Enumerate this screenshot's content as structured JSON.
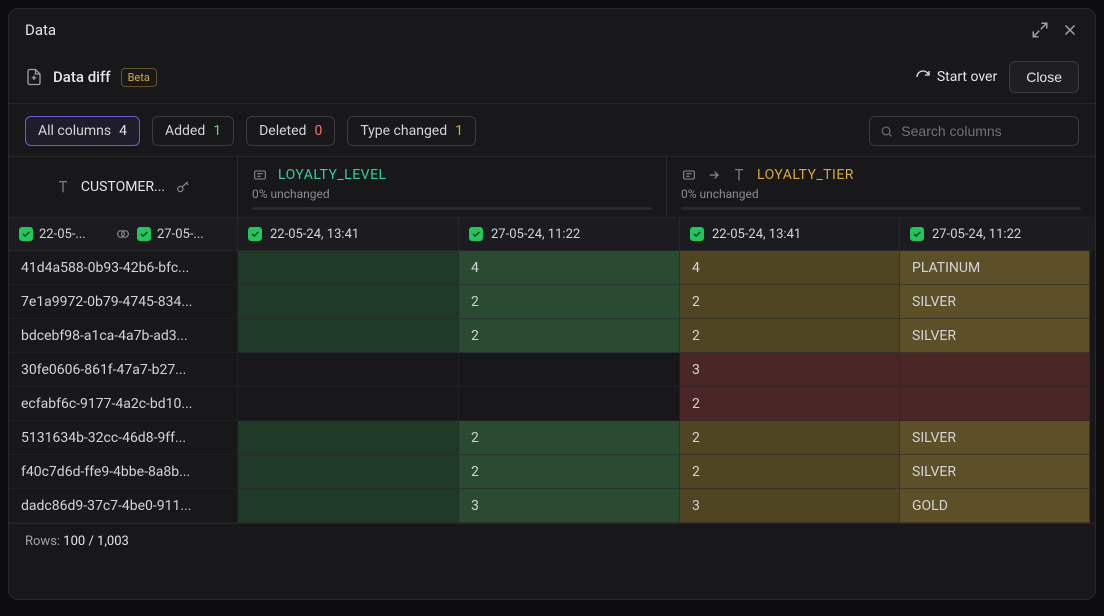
{
  "titlebar": {
    "title": "Data"
  },
  "toolbar": {
    "title": "Data diff",
    "badge": "Beta",
    "start_over": "Start over",
    "close": "Close"
  },
  "filters": {
    "all_columns": {
      "label": "All columns",
      "count": "4"
    },
    "added": {
      "label": "Added",
      "count": "1"
    },
    "deleted": {
      "label": "Deleted",
      "count": "0"
    },
    "type_changed": {
      "label": "Type changed",
      "count": "1"
    }
  },
  "search": {
    "placeholder": "Search columns"
  },
  "columns": {
    "id": {
      "label": "CUSTOMER..."
    },
    "loyalty_level": {
      "label": "LOYALTY_LEVEL",
      "sub": "0% unchanged"
    },
    "loyalty_tier": {
      "label": "LOYALTY_TIER",
      "sub": "0% unchanged"
    }
  },
  "snapshots": {
    "a": "22-05-24, 13:41",
    "b": "27-05-24, 11:22",
    "a_short": "22-05-...",
    "b_short": "27-05-..."
  },
  "rows": [
    {
      "id": "41d4a588-0b93-42b6-bfc...",
      "ll_a": "",
      "ll_b": "4",
      "lt_a": "4",
      "lt_b": "PLATINUM",
      "variant": "changed"
    },
    {
      "id": "7e1a9972-0b79-4745-834...",
      "ll_a": "",
      "ll_b": "2",
      "lt_a": "2",
      "lt_b": "SILVER",
      "variant": "changed"
    },
    {
      "id": "bdcebf98-a1ca-4a7b-ad3...",
      "ll_a": "",
      "ll_b": "2",
      "lt_a": "2",
      "lt_b": "SILVER",
      "variant": "changed"
    },
    {
      "id": "30fe0606-861f-47a7-b27...",
      "ll_a": "",
      "ll_b": "",
      "lt_a": "3",
      "lt_b": "",
      "variant": "deleted"
    },
    {
      "id": "ecfabf6c-9177-4a2c-bd10...",
      "ll_a": "",
      "ll_b": "",
      "lt_a": "2",
      "lt_b": "",
      "variant": "deleted"
    },
    {
      "id": "5131634b-32cc-46d8-9ff...",
      "ll_a": "",
      "ll_b": "2",
      "lt_a": "2",
      "lt_b": "SILVER",
      "variant": "changed"
    },
    {
      "id": "f40c7d6d-ffe9-4bbe-8a8b...",
      "ll_a": "",
      "ll_b": "2",
      "lt_a": "2",
      "lt_b": "SILVER",
      "variant": "changed"
    },
    {
      "id": "dadc86d9-37c7-4be0-911...",
      "ll_a": "",
      "ll_b": "3",
      "lt_a": "3",
      "lt_b": "GOLD",
      "variant": "changed"
    }
  ],
  "footer": {
    "prefix": "Rows:",
    "count": "100 / 1,003"
  }
}
